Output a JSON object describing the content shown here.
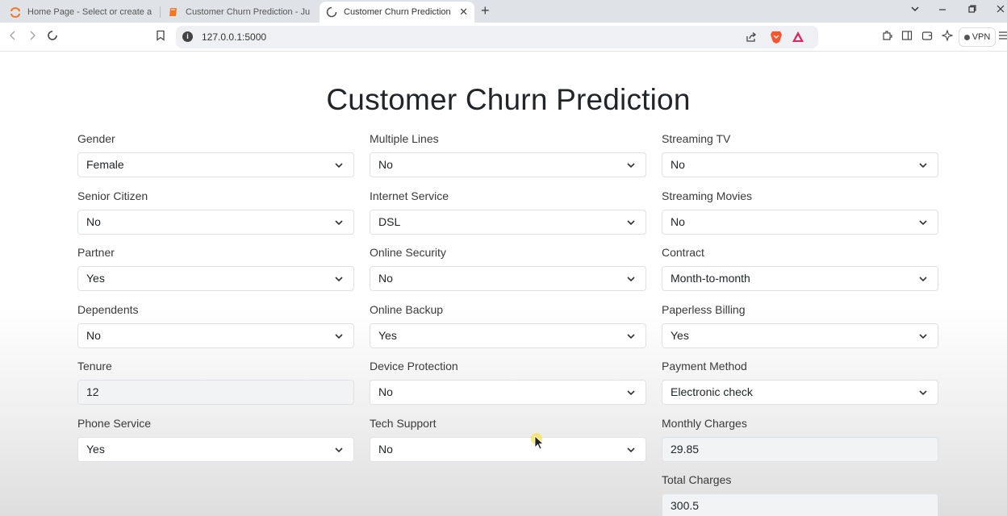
{
  "browser": {
    "tabs": [
      {
        "label": "Home Page - Select or create a notebook"
      },
      {
        "label": "Customer Churn Prediction - Jupyter Notebook"
      },
      {
        "label": "Customer Churn Prediction"
      }
    ],
    "url": "127.0.0.1:5000",
    "vpn_label": "VPN"
  },
  "page": {
    "title": "Customer Churn Prediction",
    "columns": [
      [
        {
          "label": "Gender",
          "value": "Female",
          "type": "select"
        },
        {
          "label": "Senior Citizen",
          "value": "No",
          "type": "select"
        },
        {
          "label": "Partner",
          "value": "Yes",
          "type": "select"
        },
        {
          "label": "Dependents",
          "value": "No",
          "type": "select"
        },
        {
          "label": "Tenure",
          "value": "12",
          "type": "input"
        },
        {
          "label": "Phone Service",
          "value": "Yes",
          "type": "select"
        }
      ],
      [
        {
          "label": "Multiple Lines",
          "value": "No",
          "type": "select"
        },
        {
          "label": "Internet Service",
          "value": "DSL",
          "type": "select"
        },
        {
          "label": "Online Security",
          "value": "No",
          "type": "select"
        },
        {
          "label": "Online Backup",
          "value": "Yes",
          "type": "select"
        },
        {
          "label": "Device Protection",
          "value": "No",
          "type": "select"
        },
        {
          "label": "Tech Support",
          "value": "No",
          "type": "select"
        }
      ],
      [
        {
          "label": "Streaming TV",
          "value": "No",
          "type": "select"
        },
        {
          "label": "Streaming Movies",
          "value": "No",
          "type": "select"
        },
        {
          "label": "Contract",
          "value": "Month-to-month",
          "type": "select"
        },
        {
          "label": "Paperless Billing",
          "value": "Yes",
          "type": "select"
        },
        {
          "label": "Payment Method",
          "value": "Electronic check",
          "type": "select"
        },
        {
          "label": "Monthly Charges",
          "value": "29.85",
          "type": "input"
        },
        {
          "label": "Total Charges",
          "value": "300.5",
          "type": "input"
        }
      ]
    ]
  },
  "colors": {
    "brave_orange": "#fb542b",
    "jupyter_orange": "#f37726",
    "caret": "#333333"
  }
}
